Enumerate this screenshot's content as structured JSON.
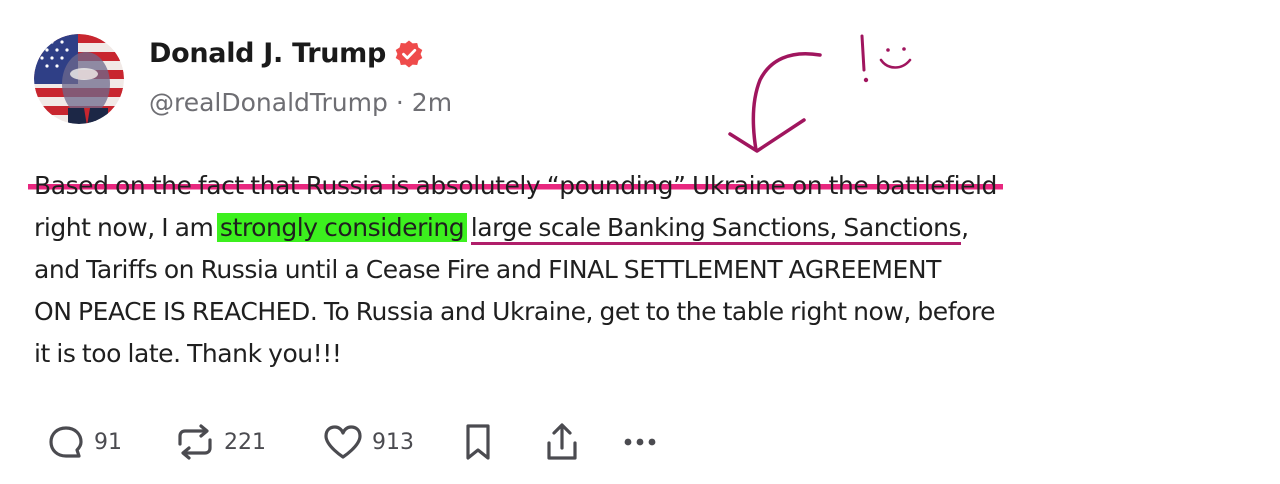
{
  "author": {
    "display_name": "Donald J. Trump",
    "handle": "@realDonaldTrump",
    "separator": "·",
    "time_ago": "2m",
    "verified": true,
    "verified_badge_color": "#ef4b4b"
  },
  "post": {
    "line1": "Based on the fact that Russia is absolutely “pounding” Ukraine on the battlefield",
    "line2_a": "right now, I am ",
    "line2_highlight": "strongly considering",
    "line2_space": " ",
    "line2_underlined": "large scale Banking Sanctions, Sanctions",
    "line2_end": ",",
    "line3": "and Tariffs on Russia until a Cease Fire and FINAL SETTLEMENT AGREEMENT",
    "line4": "ON PEACE IS REACHED. To Russia and Ukraine, get to the table right now, before",
    "line5": "it is too late. Thank you!!!"
  },
  "annotations": {
    "strike_color": "#e8277f",
    "highlight_color": "#3cf01e",
    "underline_color": "#b01e6a",
    "ink_color": "#a0155e",
    "arrow": "hand-drawn-arrow",
    "doodle": "hand-drawn-exclamation-smiley"
  },
  "actions": {
    "reply_count": "91",
    "repost_count": "221",
    "like_count": "913"
  }
}
